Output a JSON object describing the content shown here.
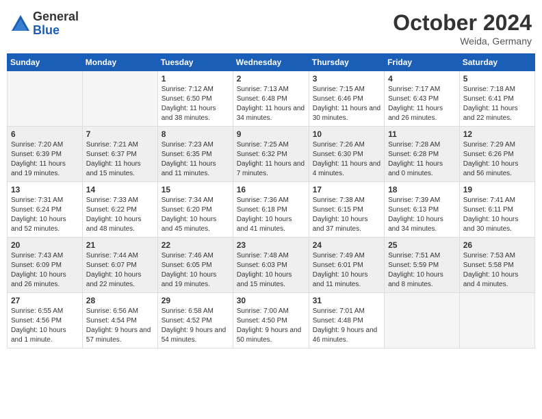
{
  "header": {
    "logo_general": "General",
    "logo_blue": "Blue",
    "month_title": "October 2024",
    "location": "Weida, Germany"
  },
  "weekdays": [
    "Sunday",
    "Monday",
    "Tuesday",
    "Wednesday",
    "Thursday",
    "Friday",
    "Saturday"
  ],
  "weeks": [
    [
      {
        "day": "",
        "details": ""
      },
      {
        "day": "",
        "details": ""
      },
      {
        "day": "1",
        "details": "Sunrise: 7:12 AM\nSunset: 6:50 PM\nDaylight: 11 hours and 38 minutes."
      },
      {
        "day": "2",
        "details": "Sunrise: 7:13 AM\nSunset: 6:48 PM\nDaylight: 11 hours and 34 minutes."
      },
      {
        "day": "3",
        "details": "Sunrise: 7:15 AM\nSunset: 6:46 PM\nDaylight: 11 hours and 30 minutes."
      },
      {
        "day": "4",
        "details": "Sunrise: 7:17 AM\nSunset: 6:43 PM\nDaylight: 11 hours and 26 minutes."
      },
      {
        "day": "5",
        "details": "Sunrise: 7:18 AM\nSunset: 6:41 PM\nDaylight: 11 hours and 22 minutes."
      }
    ],
    [
      {
        "day": "6",
        "details": "Sunrise: 7:20 AM\nSunset: 6:39 PM\nDaylight: 11 hours and 19 minutes."
      },
      {
        "day": "7",
        "details": "Sunrise: 7:21 AM\nSunset: 6:37 PM\nDaylight: 11 hours and 15 minutes."
      },
      {
        "day": "8",
        "details": "Sunrise: 7:23 AM\nSunset: 6:35 PM\nDaylight: 11 hours and 11 minutes."
      },
      {
        "day": "9",
        "details": "Sunrise: 7:25 AM\nSunset: 6:32 PM\nDaylight: 11 hours and 7 minutes."
      },
      {
        "day": "10",
        "details": "Sunrise: 7:26 AM\nSunset: 6:30 PM\nDaylight: 11 hours and 4 minutes."
      },
      {
        "day": "11",
        "details": "Sunrise: 7:28 AM\nSunset: 6:28 PM\nDaylight: 11 hours and 0 minutes."
      },
      {
        "day": "12",
        "details": "Sunrise: 7:29 AM\nSunset: 6:26 PM\nDaylight: 10 hours and 56 minutes."
      }
    ],
    [
      {
        "day": "13",
        "details": "Sunrise: 7:31 AM\nSunset: 6:24 PM\nDaylight: 10 hours and 52 minutes."
      },
      {
        "day": "14",
        "details": "Sunrise: 7:33 AM\nSunset: 6:22 PM\nDaylight: 10 hours and 48 minutes."
      },
      {
        "day": "15",
        "details": "Sunrise: 7:34 AM\nSunset: 6:20 PM\nDaylight: 10 hours and 45 minutes."
      },
      {
        "day": "16",
        "details": "Sunrise: 7:36 AM\nSunset: 6:18 PM\nDaylight: 10 hours and 41 minutes."
      },
      {
        "day": "17",
        "details": "Sunrise: 7:38 AM\nSunset: 6:15 PM\nDaylight: 10 hours and 37 minutes."
      },
      {
        "day": "18",
        "details": "Sunrise: 7:39 AM\nSunset: 6:13 PM\nDaylight: 10 hours and 34 minutes."
      },
      {
        "day": "19",
        "details": "Sunrise: 7:41 AM\nSunset: 6:11 PM\nDaylight: 10 hours and 30 minutes."
      }
    ],
    [
      {
        "day": "20",
        "details": "Sunrise: 7:43 AM\nSunset: 6:09 PM\nDaylight: 10 hours and 26 minutes."
      },
      {
        "day": "21",
        "details": "Sunrise: 7:44 AM\nSunset: 6:07 PM\nDaylight: 10 hours and 22 minutes."
      },
      {
        "day": "22",
        "details": "Sunrise: 7:46 AM\nSunset: 6:05 PM\nDaylight: 10 hours and 19 minutes."
      },
      {
        "day": "23",
        "details": "Sunrise: 7:48 AM\nSunset: 6:03 PM\nDaylight: 10 hours and 15 minutes."
      },
      {
        "day": "24",
        "details": "Sunrise: 7:49 AM\nSunset: 6:01 PM\nDaylight: 10 hours and 11 minutes."
      },
      {
        "day": "25",
        "details": "Sunrise: 7:51 AM\nSunset: 5:59 PM\nDaylight: 10 hours and 8 minutes."
      },
      {
        "day": "26",
        "details": "Sunrise: 7:53 AM\nSunset: 5:58 PM\nDaylight: 10 hours and 4 minutes."
      }
    ],
    [
      {
        "day": "27",
        "details": "Sunrise: 6:55 AM\nSunset: 4:56 PM\nDaylight: 10 hours and 1 minute."
      },
      {
        "day": "28",
        "details": "Sunrise: 6:56 AM\nSunset: 4:54 PM\nDaylight: 9 hours and 57 minutes."
      },
      {
        "day": "29",
        "details": "Sunrise: 6:58 AM\nSunset: 4:52 PM\nDaylight: 9 hours and 54 minutes."
      },
      {
        "day": "30",
        "details": "Sunrise: 7:00 AM\nSunset: 4:50 PM\nDaylight: 9 hours and 50 minutes."
      },
      {
        "day": "31",
        "details": "Sunrise: 7:01 AM\nSunset: 4:48 PM\nDaylight: 9 hours and 46 minutes."
      },
      {
        "day": "",
        "details": ""
      },
      {
        "day": "",
        "details": ""
      }
    ]
  ]
}
